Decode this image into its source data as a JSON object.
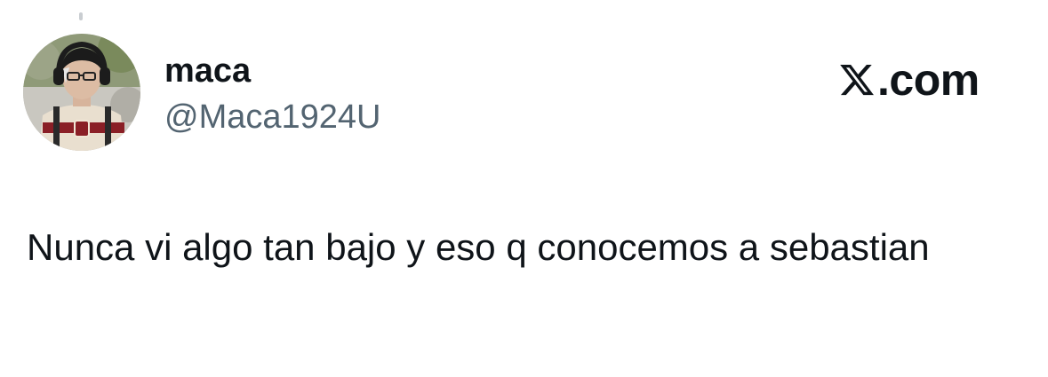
{
  "author": {
    "display_name": "maca",
    "handle": "@Maca1924U",
    "avatar_icon": "user-avatar-photo"
  },
  "watermark": {
    "logo_icon": "x-logo-icon",
    "suffix": ".com"
  },
  "tweet": {
    "text": "Nunca vi algo tan bajo y eso q conocemos a sebastian"
  },
  "colors": {
    "text_primary": "#0f1419",
    "text_secondary": "#536471",
    "background": "#ffffff"
  }
}
